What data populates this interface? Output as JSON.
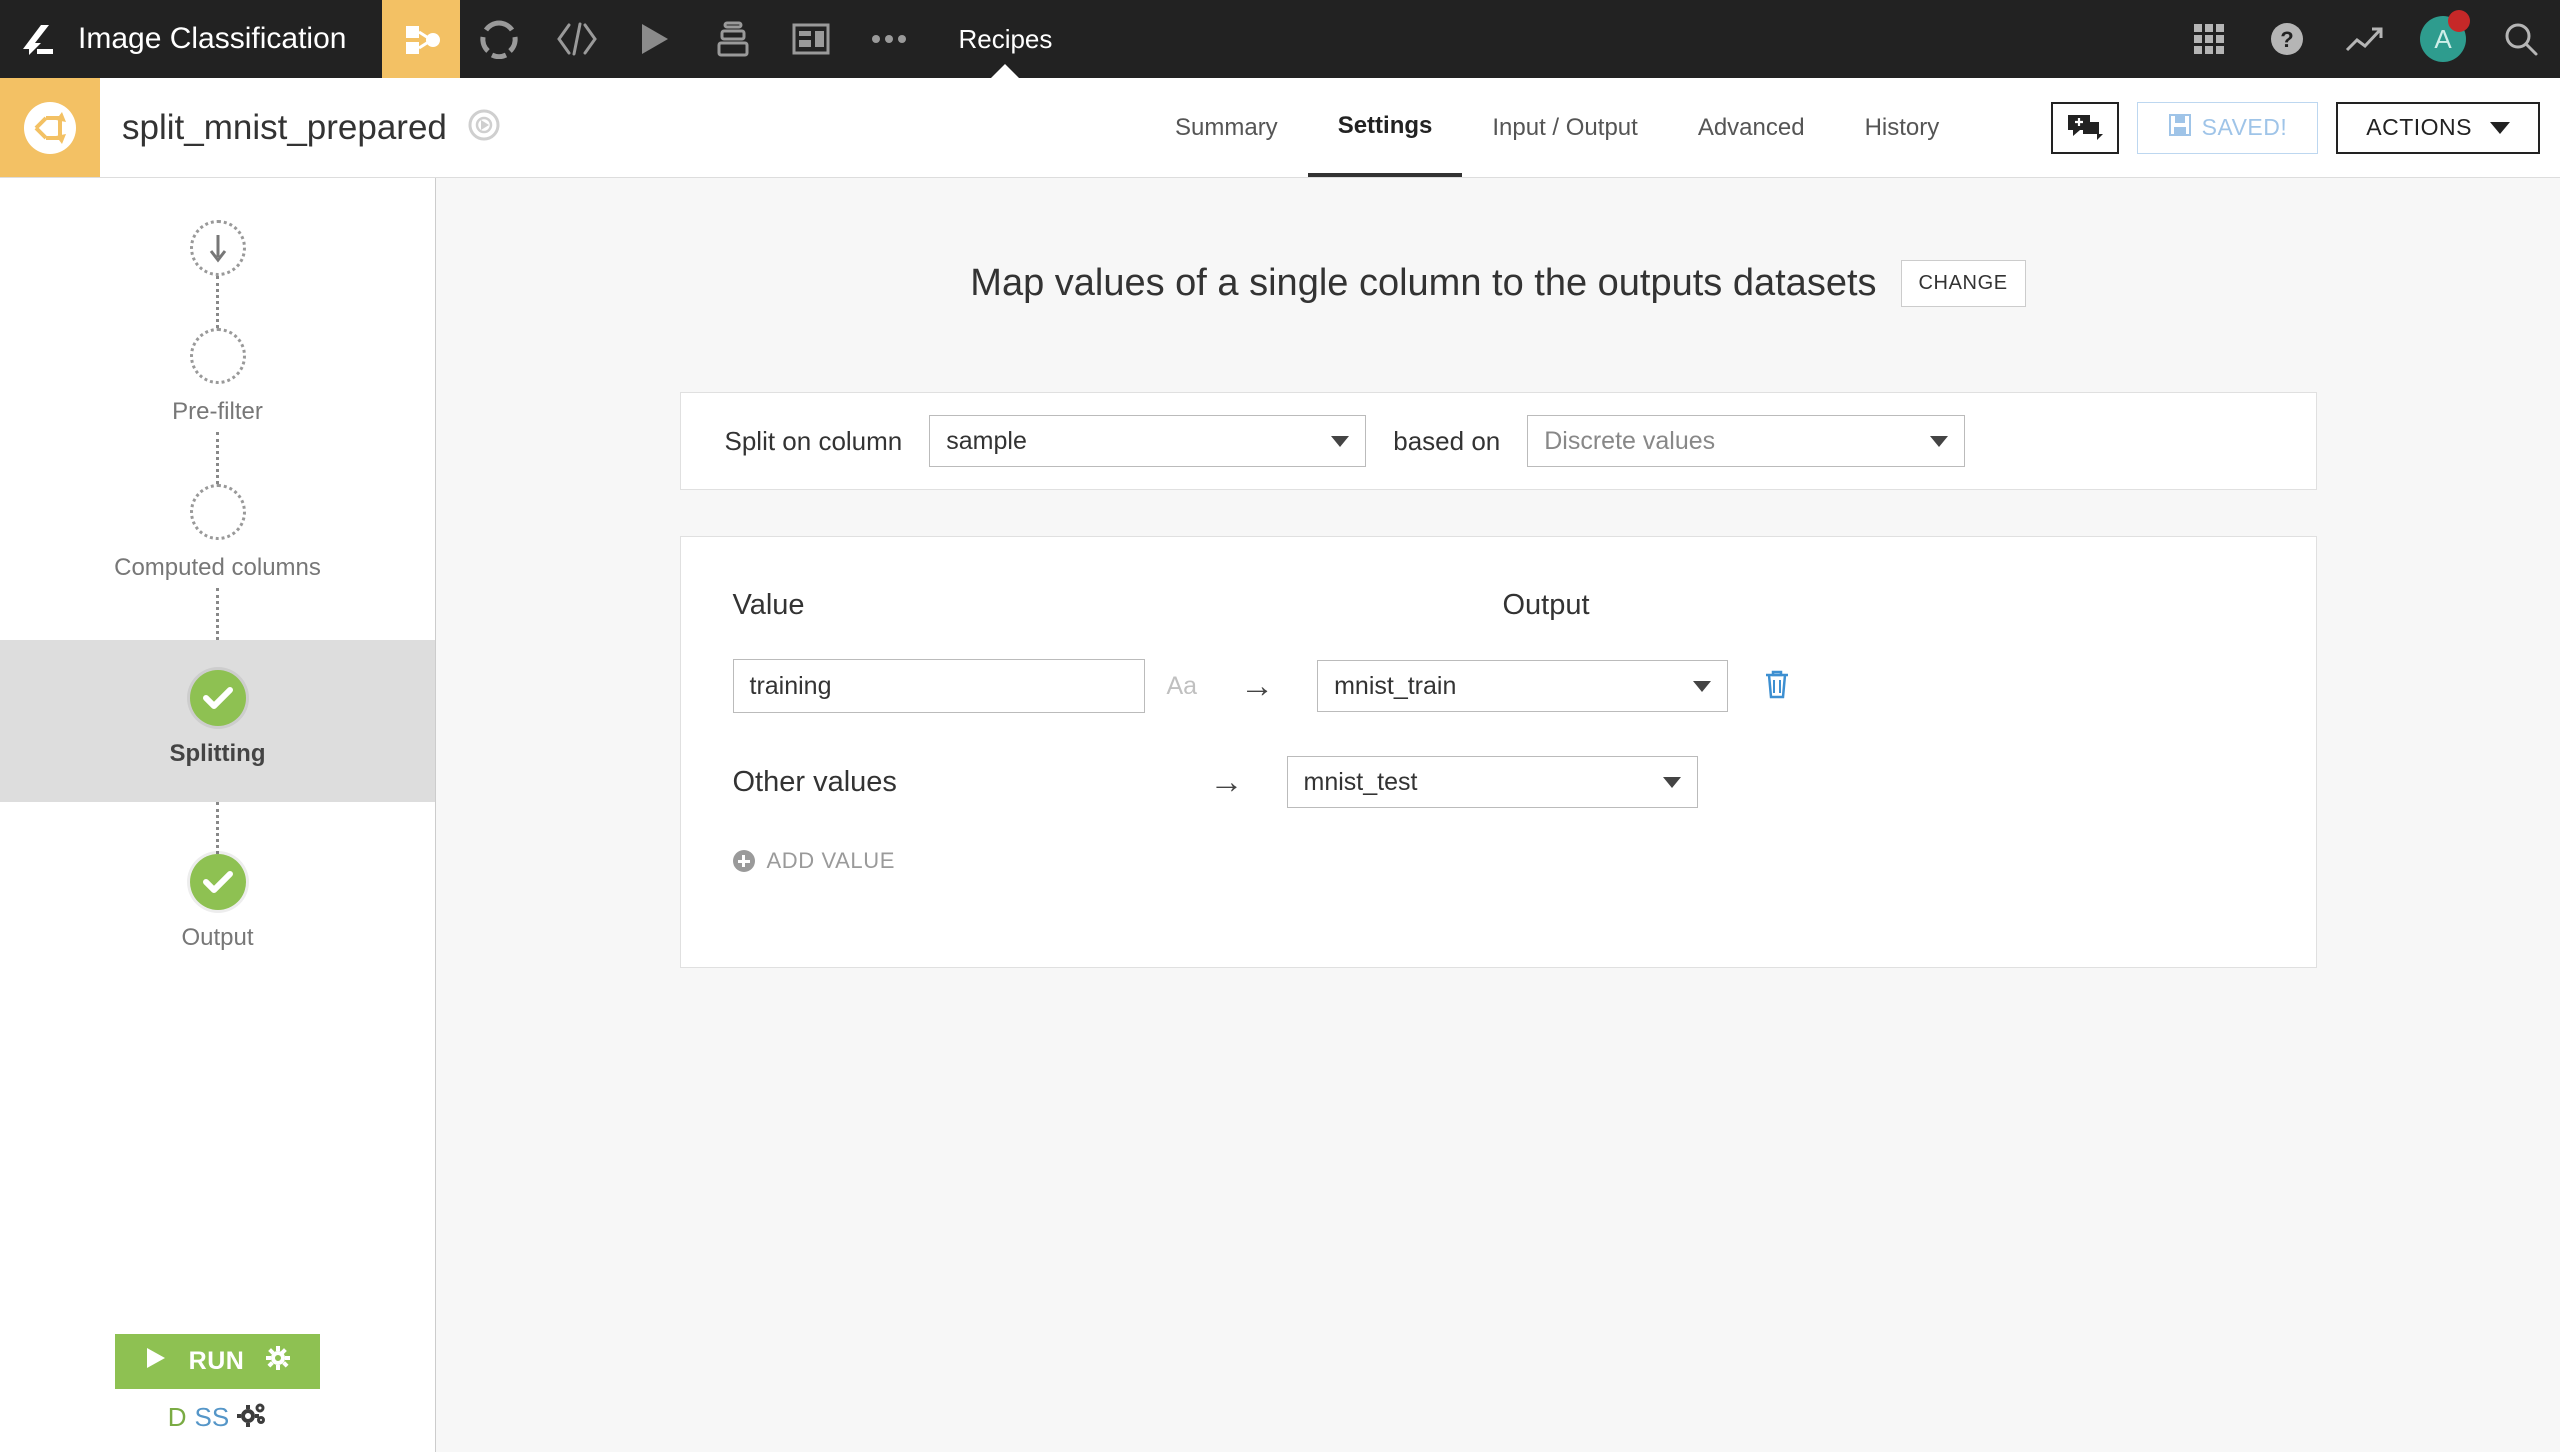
{
  "topbar": {
    "logo_icon": "dataiku-bird-logo",
    "project_name": "Image Classification",
    "icons": [
      {
        "name": "flow-icon",
        "active": true
      },
      {
        "name": "dataset-circle-icon",
        "active": false
      },
      {
        "name": "code-icon",
        "active": false
      },
      {
        "name": "run-play-icon",
        "active": false
      },
      {
        "name": "jobs-stack-icon",
        "active": false
      },
      {
        "name": "dashboard-icon",
        "active": false
      },
      {
        "name": "more-ellipsis-icon",
        "active": false
      }
    ],
    "section_label": "Recipes",
    "right_icons": [
      {
        "name": "apps-grid-icon"
      },
      {
        "name": "help-question-icon"
      },
      {
        "name": "trending-chart-icon"
      }
    ],
    "avatar_initial": "A",
    "avatar_color": "#2e9c8e",
    "badge_color": "#c62828",
    "search_icon": "search-icon",
    "background": "#222222",
    "accent": "#f3c164"
  },
  "subheader": {
    "recipe_icon": "split-recipe-icon",
    "recipe_name": "split_mnist_prepared",
    "status_icon": "compass-badge-icon",
    "tabs": [
      {
        "label": "Summary",
        "active": false
      },
      {
        "label": "Settings",
        "active": true
      },
      {
        "label": "Input / Output",
        "active": false
      },
      {
        "label": "Advanced",
        "active": false
      },
      {
        "label": "History",
        "active": false
      }
    ],
    "chat_button_icon": "chat-add-icon",
    "saved_label": "SAVED!",
    "saved_icon": "floppy-disk-icon",
    "actions_label": "ACTIONS"
  },
  "sidebar": {
    "steps": [
      {
        "label": "",
        "icon": "arrow-down-icon",
        "state": "input",
        "selected": false
      },
      {
        "label": "Pre-filter",
        "icon": "empty-circle-icon",
        "state": "empty",
        "selected": false
      },
      {
        "label": "Computed columns",
        "icon": "empty-circle-icon",
        "state": "empty",
        "selected": false
      },
      {
        "label": "Splitting",
        "icon": "check-icon",
        "state": "done",
        "selected": true
      },
      {
        "label": "Output",
        "icon": "check-icon",
        "state": "done",
        "selected": false
      }
    ],
    "run_label": "RUN",
    "run_gear_icon": "gear-icon",
    "run_play_icon": "play-icon",
    "footer_brand_d": "D",
    "footer_brand_ss": "SS",
    "footer_gears_icon": "gears-icon",
    "run_color": "#8ec152"
  },
  "main": {
    "title": "Map values of a single column to the outputs datasets",
    "change_label": "CHANGE",
    "split_panel": {
      "split_on_column_label": "Split on column",
      "column_value": "sample",
      "based_on_label": "based on",
      "based_on_value": "Discrete values"
    },
    "map_panel": {
      "header_value": "Value",
      "header_output": "Output",
      "rows": [
        {
          "value": "training",
          "hint": "Aa",
          "arrow": "→",
          "output": "mnist_train",
          "delete_icon": "trash-icon"
        }
      ],
      "other_values_label": "Other values",
      "other_values_arrow": "→",
      "other_values_output": "mnist_test",
      "add_value_label": "ADD VALUE",
      "add_value_icon": "plus-circle-icon"
    }
  }
}
